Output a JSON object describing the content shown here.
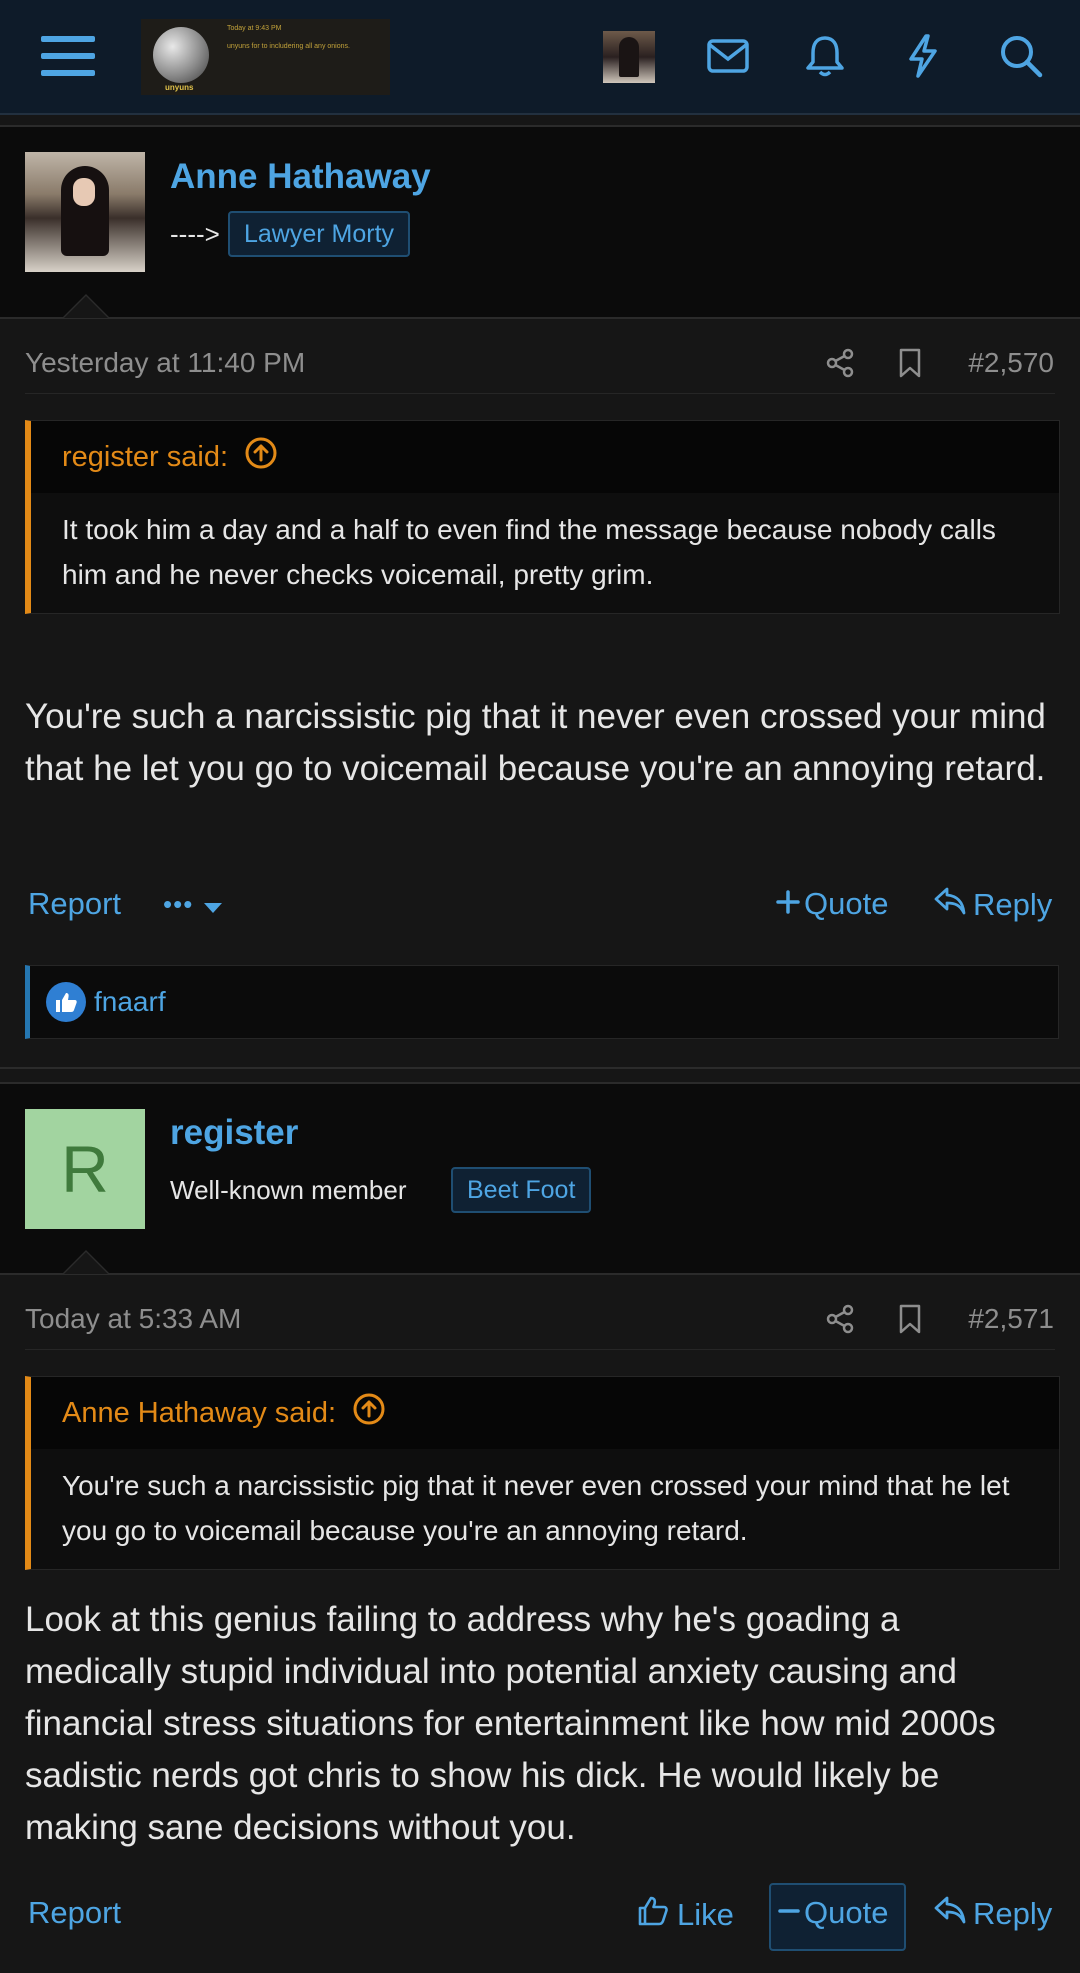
{
  "header": {
    "logo": {
      "small_line_1": "Today at 9:43 PM",
      "small_line_2": "unyuns for to includering all any onions.",
      "name": "unyuns"
    },
    "icons": [
      "menu-icon",
      "envelope-icon",
      "bell-icon",
      "bolt-icon",
      "search-icon"
    ]
  },
  "posts": [
    {
      "author": "Anne Hathaway",
      "user_title": "---->",
      "banner": "Lawyer Morty",
      "date": "Yesterday at 11:40 PM",
      "number": "#2,570",
      "quote": {
        "author_line": "register said:",
        "text": "It took him a day and a half to even find the message because nobody calls him and he never checks voicemail, pretty grim."
      },
      "body": "You're such a narcissistic pig that it never even crossed your mind that he let you go to voicemail because you're an annoying retard.",
      "actions": {
        "report": "Report",
        "more": "•••",
        "quote": "Quote",
        "reply": "Reply"
      },
      "reaction_user": "fnaarf"
    },
    {
      "author": "register",
      "avatar_letter": "R",
      "user_title": "Well-known member",
      "banner": "Beet Foot",
      "date": "Today at 5:33 AM",
      "number": "#2,571",
      "quote": {
        "author_line": "Anne Hathaway said:",
        "text": "You're such a narcissistic pig that it never even crossed your mind that he let you go to voicemail because you're an annoying retard."
      },
      "body": "Look at this genius failing to address why he's goading a medically stupid individual into potential anxiety causing and financial stress situations for entertainment like how mid 2000s sadistic nerds got chris to show his dick. He would likely be making sane decisions without you.",
      "actions": {
        "report": "Report",
        "like": "Like",
        "quote": "Quote",
        "reply": "Reply"
      }
    }
  ],
  "colors": {
    "link": "#4ea5e3",
    "quote_accent": "#e38a17",
    "header_bg": "#0e1b29",
    "page_bg": "#161616"
  }
}
